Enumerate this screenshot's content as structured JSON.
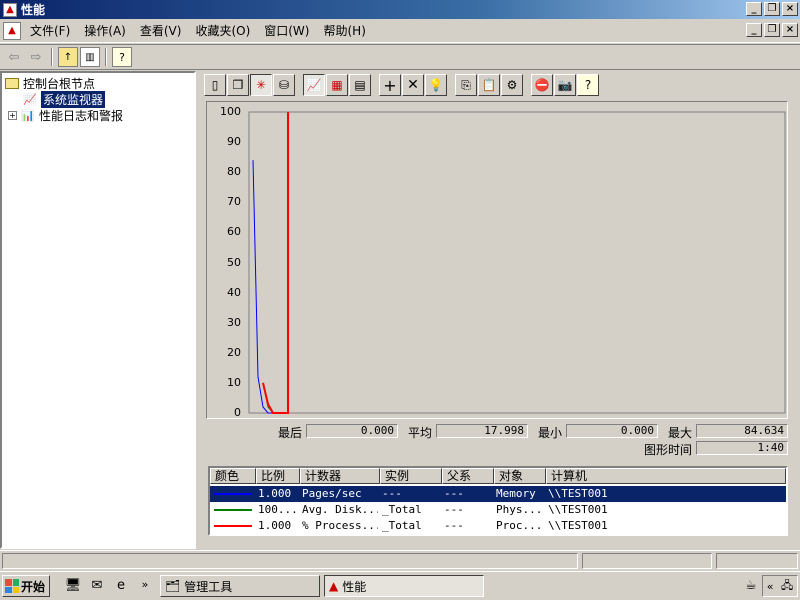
{
  "window": {
    "title": "性能"
  },
  "menu": [
    "文件(F)",
    "操作(A)",
    "查看(V)",
    "收藏夹(O)",
    "窗口(W)",
    "帮助(H)"
  ],
  "tree": {
    "root": "控制台根节点",
    "items": [
      {
        "label": "系统监视器",
        "selected": true
      },
      {
        "label": "性能日志和警报",
        "selected": false
      }
    ]
  },
  "graph": {
    "y_ticks": [
      "100",
      "90",
      "80",
      "70",
      "60",
      "50",
      "40",
      "30",
      "20",
      "10",
      "0"
    ]
  },
  "chart_data": {
    "type": "line",
    "ylim": [
      0,
      100
    ],
    "series": [
      {
        "name": "Pages/sec",
        "color": "#0000ff",
        "x": [
          0,
          1,
          2,
          3,
          4,
          5
        ],
        "values": [
          84,
          12,
          2,
          0,
          0,
          0
        ]
      },
      {
        "name": "Avg. Disk...",
        "color": "#008000",
        "x": [
          2,
          3,
          4,
          5,
          6
        ],
        "values": [
          10,
          2,
          0,
          0,
          0
        ]
      },
      {
        "name": "% Process...",
        "color": "#ff0000",
        "x": [
          2,
          3,
          4,
          5,
          6,
          7,
          7
        ],
        "values": [
          10,
          3,
          0,
          0,
          0,
          0,
          100
        ]
      }
    ]
  },
  "stats": {
    "last_label": "最后",
    "last": "0.000",
    "avg_label": "平均",
    "avg": "17.998",
    "min_label": "最小",
    "min": "0.000",
    "max_label": "最大",
    "max": "84.634",
    "duration_label": "图形时间",
    "duration": "1:40"
  },
  "legend": {
    "headers": [
      "颜色",
      "比例",
      "计数器",
      "实例",
      "父系",
      "对象",
      "计算机"
    ],
    "rows": [
      {
        "color": "#0000ff",
        "scale": "1.000",
        "counter": "Pages/sec",
        "instance": "---",
        "parent": "---",
        "object": "Memory",
        "computer": "\\\\TEST001"
      },
      {
        "color": "#008000",
        "scale": "100...",
        "counter": "Avg. Disk...",
        "instance": "_Total",
        "parent": "---",
        "object": "Phys...",
        "computer": "\\\\TEST001"
      },
      {
        "color": "#ff0000",
        "scale": "1.000",
        "counter": "% Process...",
        "instance": "_Total",
        "parent": "---",
        "object": "Proc...",
        "computer": "\\\\TEST001"
      }
    ]
  },
  "taskbar": {
    "start": "开始",
    "buttons": [
      {
        "label": "管理工具",
        "active": false
      },
      {
        "label": "性能",
        "active": true
      }
    ]
  }
}
